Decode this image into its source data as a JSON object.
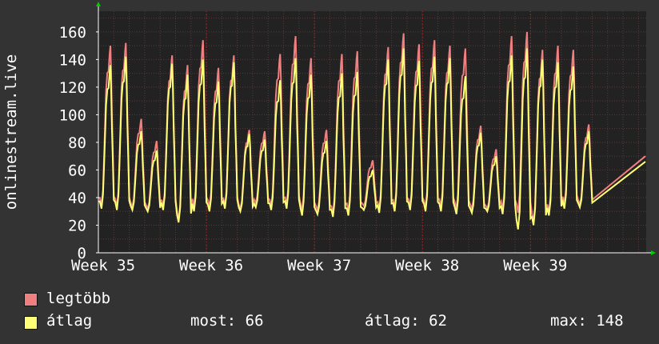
{
  "chart_data": {
    "type": "line",
    "ylabel": "onlinestream.live",
    "ylim": [
      0,
      175
    ],
    "yticks": [
      0,
      20,
      40,
      60,
      80,
      100,
      120,
      140,
      160
    ],
    "xlim_days": [
      0,
      35.5
    ],
    "xticks": [
      {
        "label": "Week 35",
        "day": 0
      },
      {
        "label": "Week 36",
        "day": 7
      },
      {
        "label": "Week 37",
        "day": 14
      },
      {
        "label": "Week 38",
        "day": 21
      },
      {
        "label": "Week 39",
        "day": 28
      }
    ],
    "daily_peaks": {
      "legtobb": [
        150,
        152,
        97,
        81,
        143,
        136,
        154,
        134,
        143,
        89,
        88,
        144,
        157,
        141,
        89,
        144,
        146,
        67,
        149,
        159,
        151,
        154,
        150,
        148,
        92,
        75,
        157,
        160,
        147,
        150,
        147,
        93
      ],
      "atlag": [
        136,
        142,
        88,
        74,
        137,
        129,
        140,
        124,
        138,
        86,
        82,
        125,
        141,
        129,
        81,
        130,
        131,
        60,
        140,
        148,
        139,
        142,
        141,
        128,
        87,
        70,
        143,
        148,
        140,
        138,
        135,
        88
      ]
    },
    "daily_troughs": {
      "legtobb": [
        34,
        33,
        33,
        32,
        33,
        24,
        33,
        33,
        34,
        32,
        36,
        33,
        34,
        30,
        31,
        28,
        30,
        34,
        31,
        32,
        33,
        32,
        33,
        31,
        32,
        32,
        31,
        29,
        22,
        29,
        35,
        35
      ],
      "atlag": [
        32,
        31,
        31,
        30,
        31,
        22,
        30,
        30,
        32,
        30,
        33,
        31,
        32,
        27,
        28,
        26,
        27,
        31,
        29,
        30,
        31,
        30,
        30,
        28,
        29,
        30,
        28,
        17,
        20,
        27,
        32,
        33
      ]
    },
    "series": [
      {
        "name": "legtöbb",
        "color": "#f07f80"
      },
      {
        "name": "átlag",
        "color": "#ffff77"
      }
    ],
    "last_value": 66,
    "grid": true
  },
  "legend": {
    "max_label": "legtöbb",
    "avg_label": "átlag",
    "now": "most: 66",
    "average": "átlag: 62",
    "maximum": "max: 148"
  },
  "colors": {
    "background": "#333333",
    "plot_background": "#222222",
    "grid_minor": "#5a3a3a",
    "grid_major": "#b03030",
    "max_color": "#f07f80",
    "avg_color": "#ffff77",
    "arrow": "#00cc00"
  }
}
